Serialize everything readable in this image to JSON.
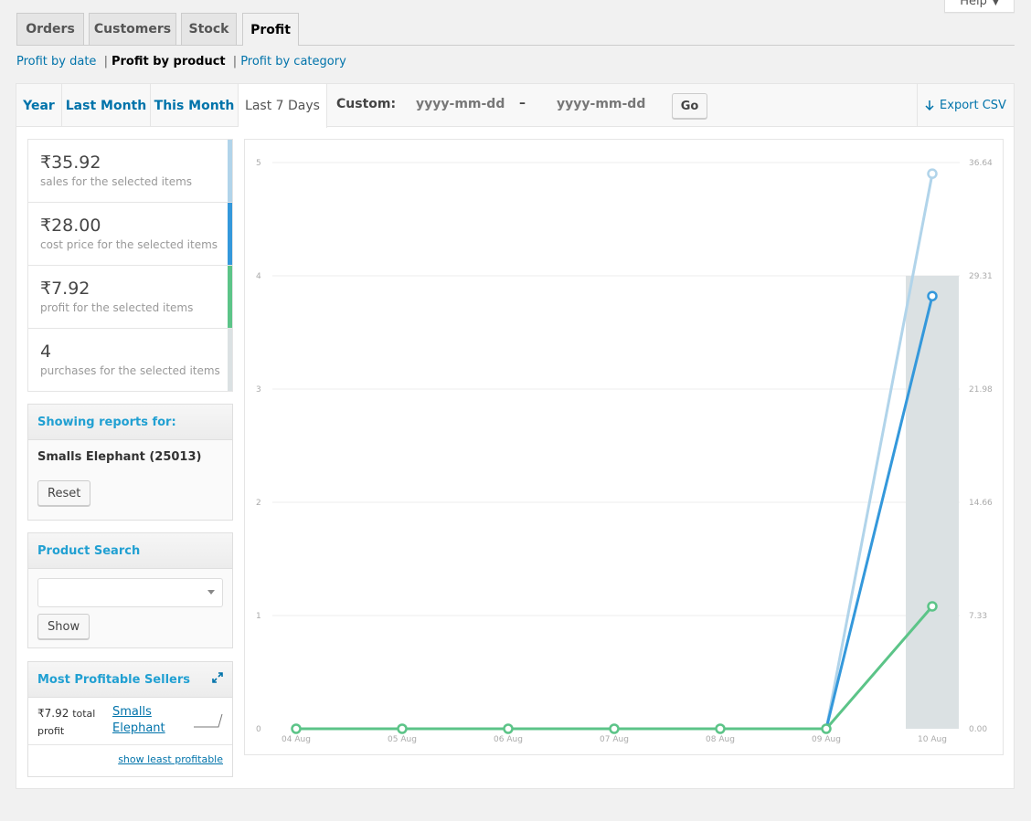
{
  "help": {
    "label": "Help"
  },
  "tabs": [
    {
      "label": "Orders"
    },
    {
      "label": "Customers"
    },
    {
      "label": "Stock"
    },
    {
      "label": "Profit"
    }
  ],
  "subnav": {
    "by_date": "Profit by date",
    "by_product": "Profit by product",
    "by_category": "Profit by category",
    "sep": "|"
  },
  "ranges": [
    {
      "label": "Year"
    },
    {
      "label": "Last Month"
    },
    {
      "label": "This Month"
    },
    {
      "label": "Last 7 Days"
    }
  ],
  "custom": {
    "label": "Custom:",
    "start_placeholder": "yyyy-mm-dd",
    "end_placeholder": "yyyy-mm-dd",
    "dash": "–",
    "go": "Go"
  },
  "export": {
    "label": "Export CSV"
  },
  "legend": [
    {
      "amount": "₹35.92",
      "desc": "sales for the selected items",
      "color": "#b1d4ea"
    },
    {
      "amount": "₹28.00",
      "desc": "cost price for the selected items",
      "color": "#3498db"
    },
    {
      "amount": "₹7.92",
      "desc": "profit for the selected items",
      "color": "#5cc488"
    },
    {
      "amount": "4",
      "desc": "purchases for the selected items",
      "color": "#dbe1e3"
    }
  ],
  "showing": {
    "title": "Showing reports for:",
    "product": "Smalls Elephant (25013)",
    "reset": "Reset"
  },
  "product_search": {
    "title": "Product Search",
    "select_value": "",
    "show": "Show"
  },
  "sellers": {
    "title": "Most Profitable Sellers",
    "amount": "₹7.92",
    "total_word": "total",
    "profit_word": "profit",
    "product_line1": "Smalls",
    "product_line2": "Elephant",
    "footer_link": "show least profitable"
  },
  "chart_data": {
    "type": "line",
    "x": [
      "04 Aug",
      "05 Aug",
      "06 Aug",
      "07 Aug",
      "08 Aug",
      "09 Aug",
      "10 Aug"
    ],
    "left_axis": {
      "ticks": [
        "0",
        "1",
        "2",
        "3",
        "4",
        "5"
      ],
      "range": [
        0,
        5
      ]
    },
    "right_axis": {
      "ticks": [
        "0.00",
        "7.33",
        "14.66",
        "21.98",
        "29.31",
        "36.64"
      ],
      "range": [
        0,
        36.64
      ]
    },
    "bars": {
      "axis": "left",
      "color": "#dbe1e3",
      "values": [
        0,
        0,
        0,
        0,
        0,
        0,
        4
      ]
    },
    "series": [
      {
        "axis": "right",
        "color": "#b1d4ea",
        "values": [
          0,
          0,
          0,
          0,
          0,
          0,
          35.92
        ]
      },
      {
        "axis": "right",
        "color": "#3498db",
        "values": [
          0,
          0,
          0,
          0,
          0,
          0,
          28.0
        ]
      },
      {
        "axis": "right",
        "color": "#5cc488",
        "values": [
          0,
          0,
          0,
          0,
          0,
          0,
          7.92
        ]
      }
    ],
    "grid": true
  }
}
